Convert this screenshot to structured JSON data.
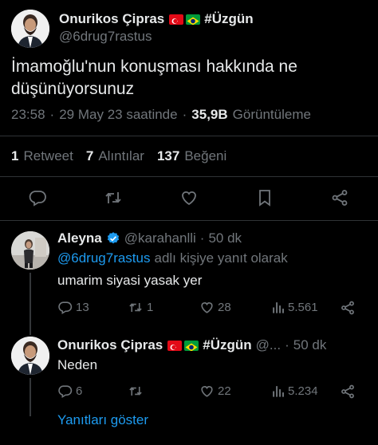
{
  "main_tweet": {
    "author_name": "Onurikos Çipras",
    "author_suffix": "#Üzgün",
    "handle": "@6drug7rastus",
    "text_line1": "İmamoğlu'nun konuşması hakkında ne",
    "text_line2": "düşünüyorsunuz",
    "time": "23:58",
    "dot1": "·",
    "date": "29 May 23 saatinde",
    "dot2": "·",
    "views_count": "35,9B",
    "views_label": "Görüntüleme",
    "retweets_count": "1",
    "retweets_label": "Retweet",
    "quotes_count": "7",
    "quotes_label": "Alıntılar",
    "likes_count": "137",
    "likes_label": "Beğeni"
  },
  "reply1": {
    "author_name": "Aleyna",
    "handle": "@karahanlli",
    "dot": "·",
    "time": "50 dk",
    "mention": "@6drug7rastus",
    "reply_to_label": "adlı kişiye yanıt olarak",
    "text": "umarim siyasi yasak yer",
    "replies": "13",
    "retweets": "1",
    "likes": "28",
    "views": "5.561"
  },
  "reply2": {
    "author_name": "Onurikos Çipras",
    "author_suffix": "#Üzgün",
    "handle": "@...",
    "dot": "·",
    "time": "50 dk",
    "text": "Neden",
    "replies": "6",
    "retweets": "",
    "likes": "22",
    "views": "5.234"
  },
  "show_replies_label": "Yanıtları göster",
  "colors": {
    "background": "#000000",
    "text": "#e7e9ea",
    "muted": "#71767b",
    "accent": "#1d9bf0",
    "divider": "#2f3336"
  },
  "icons": [
    "reply-icon",
    "retweet-icon",
    "like-icon",
    "bookmark-icon",
    "share-icon",
    "views-icon",
    "verified-badge-icon",
    "turkey-flag-icon",
    "brazil-flag-icon"
  ]
}
